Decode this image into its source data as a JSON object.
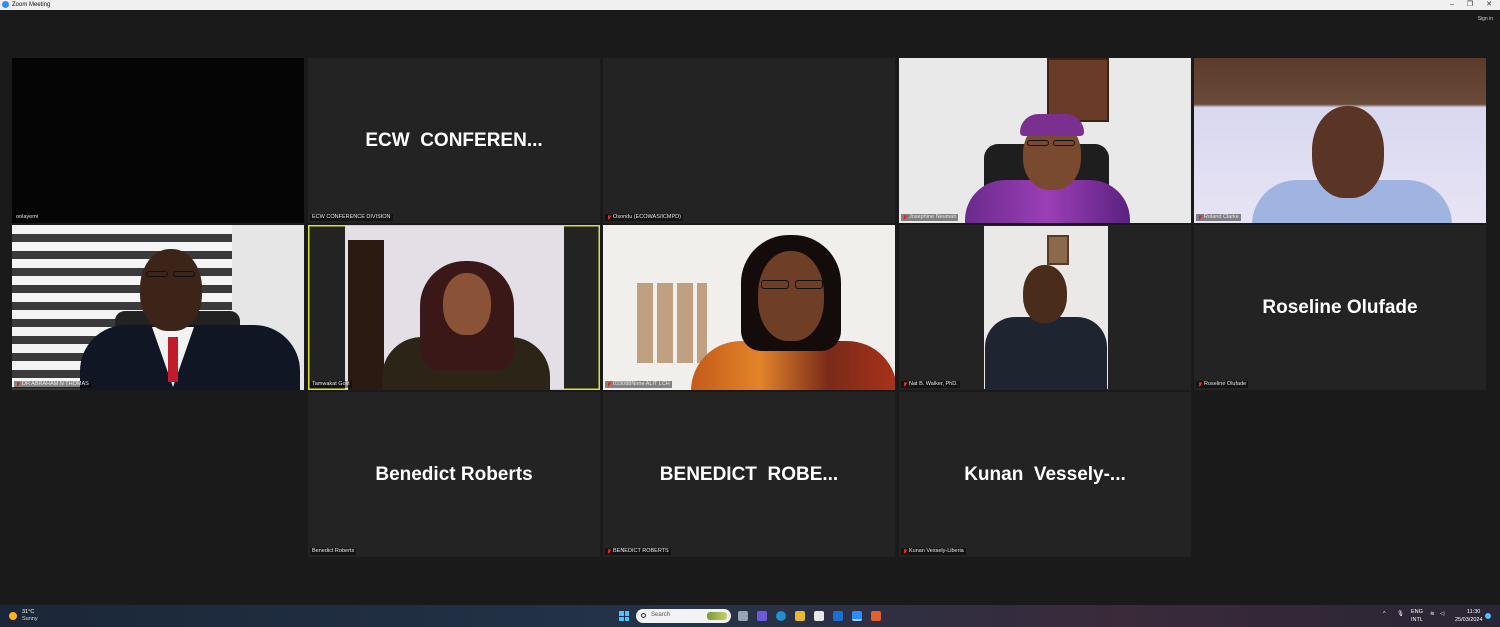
{
  "window": {
    "title": "Zoom Meeting",
    "minimize_glyph": "–",
    "maximize_glyph": "❐",
    "close_glyph": "✕",
    "sign_in": "Sign in"
  },
  "participants": [
    {
      "id": "oolayemi",
      "label": "oolayemi",
      "muted": false,
      "big_name": "",
      "video": "black"
    },
    {
      "id": "ecw-conference",
      "label": "ECW CONFERENCE DIVISION",
      "muted": false,
      "big_name": "ECW  CONFEREN...",
      "video": "none"
    },
    {
      "id": "osondu",
      "label": "Osondu (ECOWAS/ICMPD)",
      "muted": true,
      "big_name": "",
      "video": "dark"
    },
    {
      "id": "josephine",
      "label": "Josephine Neumah",
      "muted": true,
      "big_name": "",
      "video": "camera"
    },
    {
      "id": "roland",
      "label": "Roland Clarke",
      "muted": true,
      "big_name": "",
      "video": "camera"
    },
    {
      "id": "abraham",
      "label": "DR ABRAHAM N THOMAS",
      "muted": true,
      "big_name": "",
      "video": "camera"
    },
    {
      "id": "tamwakat",
      "label": "Tamwakat Golit",
      "muted": false,
      "big_name": "",
      "video": "camera",
      "active_speaker": true
    },
    {
      "id": "nneka",
      "label": "033088Nnne ALIT LCH",
      "muted": true,
      "big_name": "",
      "video": "camera"
    },
    {
      "id": "nat",
      "label": "Nat B. Walker, PhD.",
      "muted": true,
      "big_name": "",
      "video": "camera"
    },
    {
      "id": "roseline",
      "label": "Roseline Olufade",
      "muted": true,
      "big_name": "Roseline Olufade",
      "video": "none"
    },
    {
      "id": "benedict1",
      "label": "Benedict Roberts",
      "muted": false,
      "big_name": "Benedict Roberts",
      "video": "none"
    },
    {
      "id": "benedict2",
      "label": "BENEDICT ROBERTS",
      "muted": true,
      "big_name": "BENEDICT  ROBE...",
      "video": "none"
    },
    {
      "id": "kunan",
      "label": "Kunan Vessely-Liberia",
      "muted": true,
      "big_name": "Kunan  Vessely-...",
      "video": "none"
    }
  ],
  "taskbar": {
    "weather_temp": "31°C",
    "weather_cond": "Sunny",
    "search_placeholder": "Search",
    "lang_top": "ENG",
    "lang_bottom": "INTL",
    "time": "11:30",
    "date": "25/03/2024",
    "colors": {
      "start": "#4cc2ff",
      "zoom": "#2d8cff"
    }
  }
}
